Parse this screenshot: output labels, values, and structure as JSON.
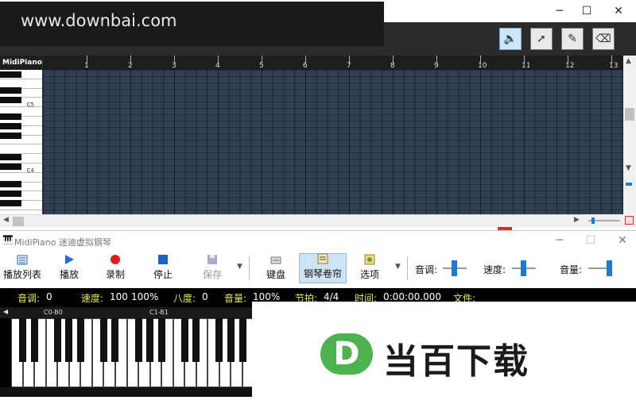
{
  "window_controls": {
    "minimize": "─",
    "maximize": "☐",
    "close": "✕"
  },
  "watermark": {
    "text": "www.downbai.com"
  },
  "piano_roll": {
    "brand": "MidiPiano",
    "octave_labels": [
      "C5",
      "C4"
    ],
    "measures": [
      "1",
      "2",
      "3",
      "4",
      "5",
      "6",
      "7",
      "8",
      "9",
      "10",
      "11",
      "12",
      "13"
    ],
    "tools": [
      {
        "name": "speaker-icon",
        "glyph": "🔈",
        "active": true
      },
      {
        "name": "pointer-icon",
        "glyph": "➚",
        "active": false
      },
      {
        "name": "pencil-icon",
        "glyph": "✎",
        "active": false
      },
      {
        "name": "eraser-icon",
        "glyph": "⌫",
        "active": false
      }
    ],
    "grid_color": "#2f4150"
  },
  "midipiano": {
    "title": "MidiPiano 迷迪虚拟钢琴",
    "toolbar": {
      "playlist": "播放列表",
      "play": "播放",
      "record": "录制",
      "stop": "停止",
      "save": "保存",
      "keyboard": "键盘",
      "pianoroll": "钢琴卷帘",
      "options": "选项",
      "pitch_label": "音调:",
      "speed_label": "速度:",
      "volume_label": "音量:"
    },
    "status": {
      "pitch": "音调:",
      "pitch_val": "0",
      "speed": "速度:",
      "speed_val": "100",
      "speed_pct": "100%",
      "octave": "八度:",
      "octave_val": "0",
      "volume": "音量:",
      "volume_val": "100%",
      "beat": "节拍:",
      "beat_val": "4/4",
      "time": "时间:",
      "time_val": "0:00:00.000",
      "file": "文件:"
    },
    "keyboard": {
      "octave_left": "C0-B0",
      "octave_right": "C1-B1"
    }
  },
  "logo": {
    "letter": "D",
    "text": "当百下载"
  }
}
